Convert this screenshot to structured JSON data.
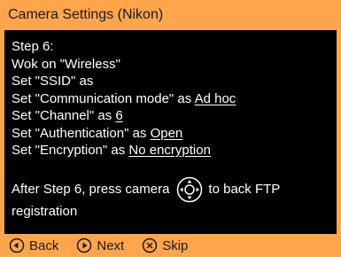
{
  "window": {
    "title": "Camera Settings (Nikon)"
  },
  "instructions": {
    "step_heading": "Step 6:",
    "wok_line": "Wok on \"Wireless\"",
    "ssid_line": "Set \"SSID\" as",
    "comm_prefix": "Set \"Communication mode\" as ",
    "comm_value": "Ad hoc",
    "channel_prefix": "Set \"Channel\" as ",
    "channel_value": "6",
    "auth_prefix": "Set \"Authentication\" as ",
    "auth_value": "Open",
    "enc_prefix": "Set \"Encryption\" as ",
    "enc_value": "No encryption",
    "after_prefix": "After Step 6, press camera",
    "after_suffix": "to back FTP",
    "after_line2": "registration"
  },
  "icons": {
    "camera_dial": "multi-selector-dial-icon",
    "back": "circle-left-arrow-icon",
    "next": "circle-right-arrow-icon",
    "skip": "circle-x-icon"
  },
  "nav": {
    "back_label": "Back",
    "next_label": "Next",
    "skip_label": "Skip"
  },
  "colors": {
    "accent": "#ffa64d",
    "content_bg": "#000000",
    "content_text": "#ffffff"
  }
}
